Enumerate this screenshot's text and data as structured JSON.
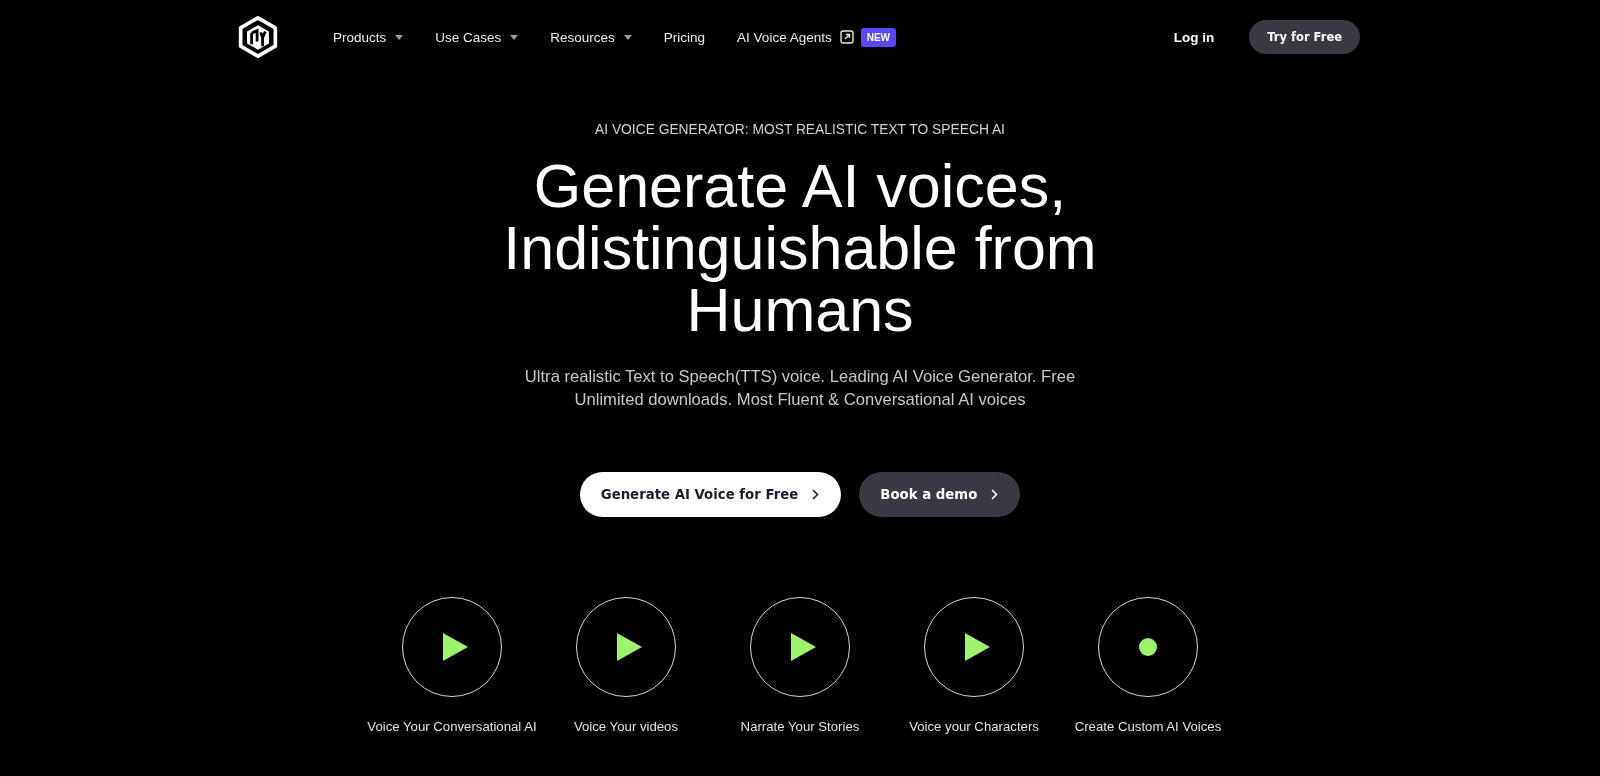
{
  "nav": {
    "items": [
      {
        "label": "Products",
        "dropdown": true,
        "external": false
      },
      {
        "label": "Use Cases",
        "dropdown": true,
        "external": false
      },
      {
        "label": "Resources",
        "dropdown": true,
        "external": false
      },
      {
        "label": "Pricing",
        "dropdown": false,
        "external": false
      },
      {
        "label": "AI Voice Agents",
        "dropdown": false,
        "external": true,
        "badge": "NEW"
      }
    ],
    "login": "Log in",
    "cta": "Try for Free"
  },
  "hero": {
    "eyebrow": "AI VOICE GENERATOR: MOST REALISTIC TEXT TO SPEECH AI",
    "title": "Generate AI voices, Indistinguishable from Humans",
    "subtitle": "Ultra realistic Text to Speech(TTS) voice. Leading AI Voice Generator. Free Unlimited downloads. Most Fluent & Conversational AI voices",
    "buttons": [
      {
        "label": "Generate AI Voice for Free",
        "kind": "primary"
      },
      {
        "label": "Book a demo",
        "kind": "secondary"
      }
    ]
  },
  "samples": [
    {
      "label": "Voice Your Conversational AI",
      "kind": "play"
    },
    {
      "label": "Voice Your videos",
      "kind": "play"
    },
    {
      "label": "Narrate Your Stories",
      "kind": "play"
    },
    {
      "label": "Voice your Characters",
      "kind": "play"
    },
    {
      "label": "Create Custom AI Voices",
      "kind": "record"
    }
  ]
}
